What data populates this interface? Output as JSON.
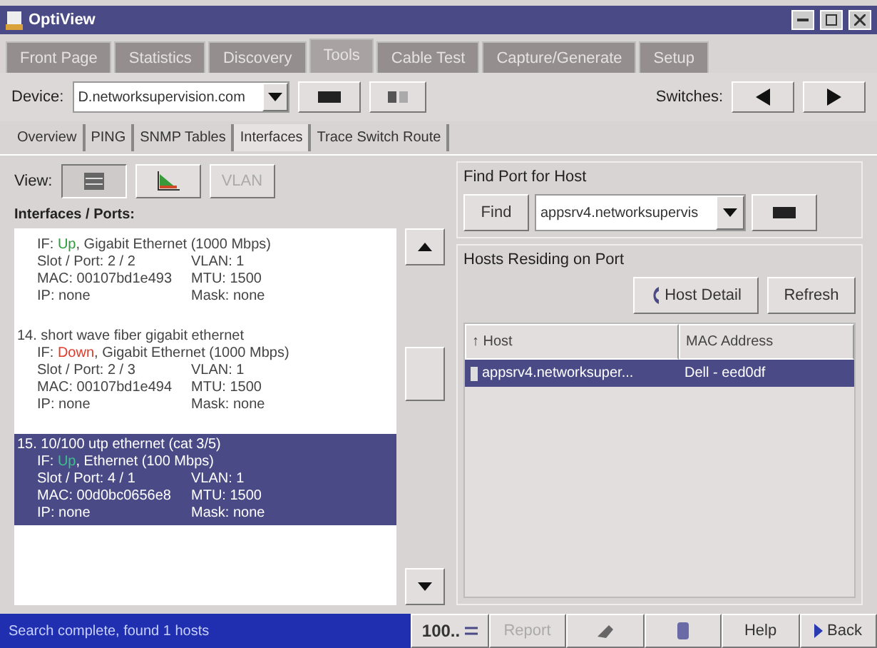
{
  "window": {
    "title": "OptiView"
  },
  "main_tabs": [
    {
      "label": "Front Page",
      "selected": false
    },
    {
      "label": "Statistics",
      "selected": false
    },
    {
      "label": "Discovery",
      "selected": false
    },
    {
      "label": "Tools",
      "selected": true
    },
    {
      "label": "Cable Test",
      "selected": false
    },
    {
      "label": "Capture/Generate",
      "selected": false
    },
    {
      "label": "Setup",
      "selected": false
    }
  ],
  "device": {
    "label": "Device:",
    "value": "D.networksupervision.com",
    "switches_label": "Switches:"
  },
  "sub_tabs": [
    {
      "label": "Overview",
      "selected": false
    },
    {
      "label": "PING",
      "selected": false
    },
    {
      "label": "SNMP Tables",
      "selected": false
    },
    {
      "label": "Interfaces",
      "selected": true
    },
    {
      "label": "Trace Switch Route",
      "selected": false
    }
  ],
  "interfaces": {
    "view_label": "View:",
    "view_buttons": [
      {
        "kind": "list",
        "selected": true,
        "disabled": false
      },
      {
        "kind": "chart",
        "selected": false,
        "disabled": false
      },
      {
        "kind": "text",
        "label": "VLAN",
        "selected": false,
        "disabled": true
      }
    ],
    "title": "Interfaces / Ports:",
    "ports": [
      {
        "if_label": "IF: ",
        "status": "Up",
        "color": "#2e9a3a",
        "rest": ", Gigabit Ethernet (1000 Mbps)",
        "slot": "Slot / Port: 2 / 2",
        "vlan": "VLAN: 1",
        "mac": "MAC: 00107bd1e493",
        "mtu": "MTU: 1500",
        "ip": "IP: none",
        "mask": "Mask: none",
        "selected": false
      },
      {
        "name": "14. short wave fiber gigabit ethernet",
        "if_label": "IF: ",
        "status": "Down",
        "color": "#e03a2a",
        "rest": ", Gigabit Ethernet (1000 Mbps)",
        "slot": "Slot / Port: 2 / 3",
        "vlan": "VLAN: 1",
        "mac": "MAC: 00107bd1e494",
        "mtu": "MTU: 1500",
        "ip": "IP: none",
        "mask": "Mask: none",
        "selected": false
      },
      {
        "name": "15. 10/100 utp ethernet (cat 3/5)",
        "if_label": "IF: ",
        "status": "Up",
        "color": "#3fbf8f",
        "rest": ", Ethernet (100 Mbps)",
        "slot": "Slot / Port: 4 / 1",
        "vlan": "VLAN: 1",
        "mac": "MAC: 00d0bc0656e8",
        "mtu": "MTU: 1500",
        "ip": "IP: none",
        "mask": "Mask: none",
        "selected": true
      }
    ]
  },
  "find_port": {
    "title": "Find Port for Host",
    "button": "Find",
    "value": "appsrv4.networksupervis"
  },
  "hosts": {
    "title": "Hosts Residing on Port",
    "detail_button": "Host Detail",
    "refresh_button": "Refresh",
    "columns": [
      "↑ Host",
      "MAC Address"
    ],
    "rows": [
      {
        "host": "appsrv4.networksuper...",
        "mac": "Dell - eed0df",
        "selected": true
      }
    ]
  },
  "status_bar": {
    "message": "Search complete, found 1 hosts",
    "zoom": "100..",
    "report": "Report",
    "help": "Help",
    "back": "Back"
  }
}
